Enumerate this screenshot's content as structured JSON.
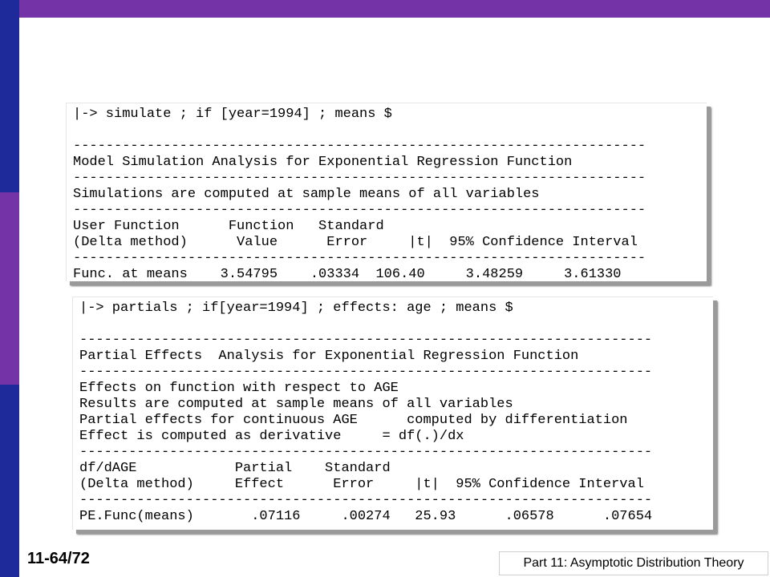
{
  "panel1": {
    "lines": [
      "|-> simulate ; if [year=1994] ; means $",
      "",
      "----------------------------------------------------------------------",
      "Model Simulation Analysis for Exponential Regression Function",
      "----------------------------------------------------------------------",
      "Simulations are computed at sample means of all variables",
      "----------------------------------------------------------------------",
      "User Function      Function   Standard",
      "(Delta method)      Value      Error     |t|  95% Confidence Interval",
      "----------------------------------------------------------------------",
      "Func. at means    3.54795    .03334  106.40     3.48259     3.61330"
    ]
  },
  "panel2": {
    "lines": [
      "|-> partials ; if[year=1994] ; effects: age ; means $",
      "",
      "----------------------------------------------------------------------",
      "Partial Effects  Analysis for Exponential Regression Function",
      "----------------------------------------------------------------------",
      "Effects on function with respect to AGE",
      "Results are computed at sample means of all variables",
      "Partial effects for continuous AGE      computed by differentiation",
      "Effect is computed as derivative     = df(.)/dx",
      "----------------------------------------------------------------------",
      "df/dAGE            Partial    Standard",
      "(Delta method)     Effect      Error     |t|  95% Confidence Interval",
      "----------------------------------------------------------------------",
      "PE.Func(means)       .07116     .00274   25.93      .06578      .07654"
    ]
  },
  "footer": {
    "slide_number": "11-64/72",
    "title": "Part 11: Asymptotic Distribution Theory"
  }
}
